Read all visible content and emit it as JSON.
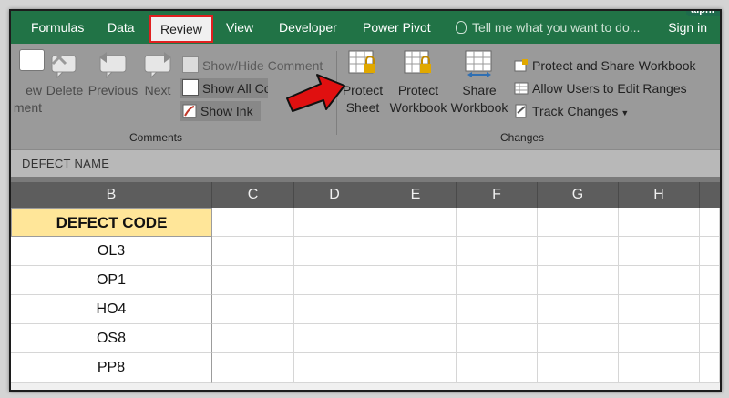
{
  "tabs": [
    {
      "label": "Formulas",
      "active": false
    },
    {
      "label": "Data",
      "active": false
    },
    {
      "label": "Review",
      "active": true
    },
    {
      "label": "View",
      "active": false
    },
    {
      "label": "Developer",
      "active": false
    },
    {
      "label": "Power Pivot",
      "active": false
    }
  ],
  "tell_me": "Tell me what you want to do...",
  "sign_in": "Sign in",
  "watermark": "alphr",
  "comments_group": {
    "label": "Comments",
    "new_comment_line1": "ew",
    "new_comment_line2": "ment",
    "delete": "Delete",
    "previous": "Previous",
    "next": "Next",
    "show_hide_comment": "Show/Hide Comment",
    "show_all_comments": "Show All Com",
    "show_ink": "Show Ink"
  },
  "changes_group": {
    "label": "Changes",
    "protect_sheet_line1": "Protect",
    "protect_sheet_line2": "Sheet",
    "protect_workbook_line1": "Protect",
    "protect_workbook_line2": "Workbook",
    "share_workbook_line1": "Share",
    "share_workbook_line2": "Workbook",
    "protect_share_workbook": "Protect and Share Workbook",
    "allow_users_edit_ranges": "Allow Users to Edit Ranges",
    "track_changes": "Track Changes"
  },
  "name_box": "DEFECT NAME",
  "columns": [
    "B",
    "C",
    "D",
    "E",
    "F",
    "G",
    "H"
  ],
  "sheet": {
    "header": "DEFECT CODE",
    "rows": [
      "OL3",
      "OP1",
      "HO4",
      "OS8",
      "PP8"
    ]
  },
  "colors": {
    "tab_bar": "#217346",
    "highlight_box": "#e02020",
    "header_fill": "#ffe699",
    "arrow": "#e01010"
  }
}
